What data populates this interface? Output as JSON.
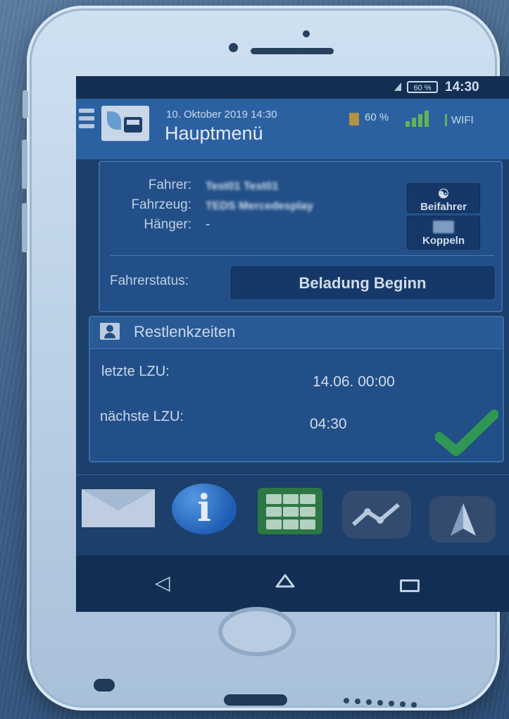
{
  "status_bar": {
    "battery": "60 %",
    "time": "14:30"
  },
  "header": {
    "date": "10. Oktober 2019 14:30",
    "title": "Hauptmenü",
    "battery": "60 %",
    "network": "WIFI",
    "menu_icon": "hamburger-icon",
    "logo_icon": "truck-leaf-logo"
  },
  "driver_info": {
    "driver_label": "Fahrer:",
    "driver_value": "Test01 Test01",
    "vehicle_label": "Fahrzeug:",
    "vehicle_value": "TEDS Mercedesplay",
    "trailer_label": "Hänger:",
    "trailer_value": "-",
    "codriver_button": "Beifahrer",
    "couple_button": "Koppeln",
    "status_label": "Fahrerstatus:",
    "status_value": "Beladung Beginn"
  },
  "rest_times": {
    "title": "Restlenkzeiten",
    "last_label": "letzte LZU:",
    "last_value": "14.06. 00:00",
    "next_label": "nächste LZU:",
    "next_value": "04:30",
    "status_icon": "checkmark-icon"
  },
  "bottom_nav": [
    "mail-icon",
    "info-icon",
    "grid-icon",
    "chart-icon",
    "navigation-icon"
  ],
  "system_nav": [
    "back-icon",
    "home-icon",
    "recents-icon"
  ]
}
